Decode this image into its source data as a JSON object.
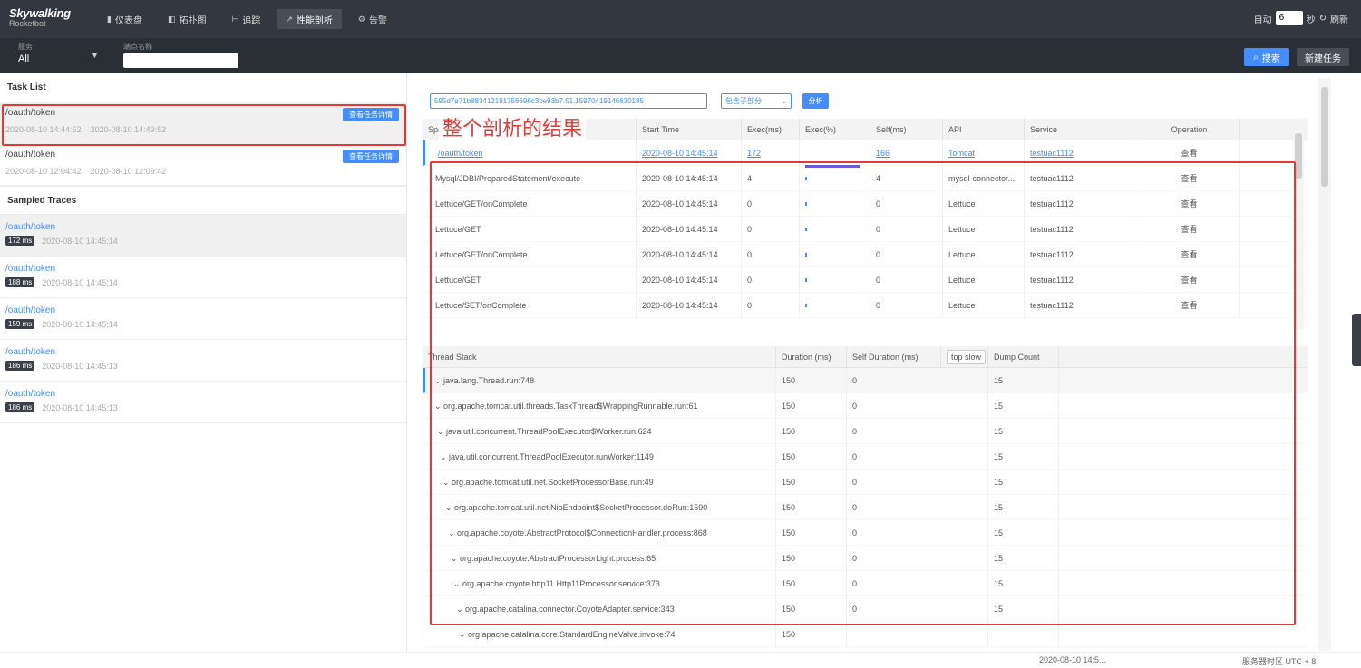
{
  "header": {
    "logo_top": "Skywalking",
    "logo_bottom": "Rocketbot",
    "nav": [
      {
        "icon": "dashboard-icon",
        "glyph": "▮",
        "label": "仪表盘",
        "active": false
      },
      {
        "icon": "topology-icon",
        "glyph": "◧",
        "label": "拓扑图",
        "active": false
      },
      {
        "icon": "trace-icon",
        "glyph": "⊢",
        "label": "追踪",
        "active": false
      },
      {
        "icon": "profile-icon",
        "glyph": "↗",
        "label": "性能剖析",
        "active": true
      },
      {
        "icon": "alarm-icon",
        "glyph": "⚙",
        "label": "告警",
        "active": false
      }
    ],
    "auto_label": "自动",
    "interval_value": "6",
    "seconds_label": "秒",
    "refresh_icon": "↻",
    "refresh_label": "刷新"
  },
  "filter": {
    "service_label": "服务",
    "service_value": "All",
    "endpoint_label": "端点名称",
    "endpoint_value": "",
    "search_button": "搜索",
    "search_icon": "⌕",
    "new_task_button": "新建任务"
  },
  "left": {
    "task_list_title": "Task List",
    "tasks": [
      {
        "endpoint": "/oauth/token",
        "start": "2020-08-10 14:44:52",
        "end": "2020-08-10 14:49:52",
        "button": "查看任务详情"
      },
      {
        "endpoint": "/oauth/token",
        "start": "2020-08-10 12:04:42",
        "end": "2020-08-10 12:09:42",
        "button": "查看任务详情"
      }
    ],
    "sampled_title": "Sampled Traces",
    "traces": [
      {
        "endpoint": "/oauth/token",
        "duration": "172 ms",
        "time": "2020-08-10 14:45:14"
      },
      {
        "endpoint": "/oauth/token",
        "duration": "188 ms",
        "time": "2020-08-10 14:45:14"
      },
      {
        "endpoint": "/oauth/token",
        "duration": "159 ms",
        "time": "2020-08-10 14:45:14"
      },
      {
        "endpoint": "/oauth/token",
        "duration": "186 ms",
        "time": "2020-08-10 14:45:13"
      },
      {
        "endpoint": "/oauth/token",
        "duration": "186 ms",
        "time": "2020-08-10 14:45:13"
      }
    ]
  },
  "right": {
    "trace_id": "595d7e71b883412191756696c3be93b7.51.15970419146630185",
    "mode": "包含子部分",
    "analyze_button": "分析",
    "span_headers": [
      "Span",
      "Start Time",
      "Exec(ms)",
      "Exec(%)",
      "Self(ms)",
      "API",
      "Service",
      "Operation"
    ],
    "spans": [
      {
        "name": "/oauth/token",
        "start": "2020-08-10 14:45:14",
        "exec": "172",
        "self": "166",
        "api": "Tomcat",
        "service": "testuac1112",
        "op": "查看"
      },
      {
        "name": "Mysql/JDBI/PreparedStatement/execute",
        "start": "2020-08-10 14:45:14",
        "exec": "4",
        "self": "4",
        "api": "mysql-connector...",
        "service": "testuac1112",
        "op": "查看"
      },
      {
        "name": "Lettuce/GET/onComplete",
        "start": "2020-08-10 14:45:14",
        "exec": "0",
        "self": "0",
        "api": "Lettuce",
        "service": "testuac1112",
        "op": "查看"
      },
      {
        "name": "Lettuce/GET",
        "start": "2020-08-10 14:45:14",
        "exec": "0",
        "self": "0",
        "api": "Lettuce",
        "service": "testuac1112",
        "op": "查看"
      },
      {
        "name": "Lettuce/GET/onComplete",
        "start": "2020-08-10 14:45:14",
        "exec": "0",
        "self": "0",
        "api": "Lettuce",
        "service": "testuac1112",
        "op": "查看"
      },
      {
        "name": "Lettuce/GET",
        "start": "2020-08-10 14:45:14",
        "exec": "0",
        "self": "0",
        "api": "Lettuce",
        "service": "testuac1112",
        "op": "查看"
      },
      {
        "name": "Lettuce/SET/onComplete",
        "start": "2020-08-10 14:45:14",
        "exec": "0",
        "self": "0",
        "api": "Lettuce",
        "service": "testuac1112",
        "op": "查看"
      }
    ],
    "stack_headers": [
      "Thread Stack",
      "Duration (ms)",
      "Self Duration (ms)",
      "top slow",
      "Dump Count"
    ],
    "stack": [
      {
        "frame": "java.lang.Thread.run:748",
        "duration": "150",
        "self": "0",
        "count": "15"
      },
      {
        "frame": "org.apache.tomcat.util.threads.TaskThread$WrappingRunnable.run:61",
        "duration": "150",
        "self": "0",
        "count": "15"
      },
      {
        "frame": "java.util.concurrent.ThreadPoolExecutor$Worker.run:624",
        "duration": "150",
        "self": "0",
        "count": "15"
      },
      {
        "frame": "java.util.concurrent.ThreadPoolExecutor.runWorker:1149",
        "duration": "150",
        "self": "0",
        "count": "15"
      },
      {
        "frame": "org.apache.tomcat.util.net.SocketProcessorBase.run:49",
        "duration": "150",
        "self": "0",
        "count": "15"
      },
      {
        "frame": "org.apache.tomcat.util.net.NioEndpoint$SocketProcessor.doRun:1590",
        "duration": "150",
        "self": "0",
        "count": "15"
      },
      {
        "frame": "org.apache.coyote.AbstractProtocol$ConnectionHandler.process:868",
        "duration": "150",
        "self": "0",
        "count": "15"
      },
      {
        "frame": "org.apache.coyote.AbstractProcessorLight.process:65",
        "duration": "150",
        "self": "0",
        "count": "15"
      },
      {
        "frame": "org.apache.coyote.http11.Http11Processor.service:373",
        "duration": "150",
        "self": "0",
        "count": "15"
      },
      {
        "frame": "org.apache.catalina.connector.CoyoteAdapter.service:343",
        "duration": "150",
        "self": "0",
        "count": "15"
      },
      {
        "frame": "org.apache.catalina.core.StandardEngineValve.invoke:74",
        "duration": "150",
        "self": "",
        "count": ""
      }
    ]
  },
  "annotation": {
    "text": "整个剖析的结果"
  },
  "footer": {
    "time": "2020-08-10 14:5...",
    "timezone": "服务器时区 UTC + 8"
  }
}
